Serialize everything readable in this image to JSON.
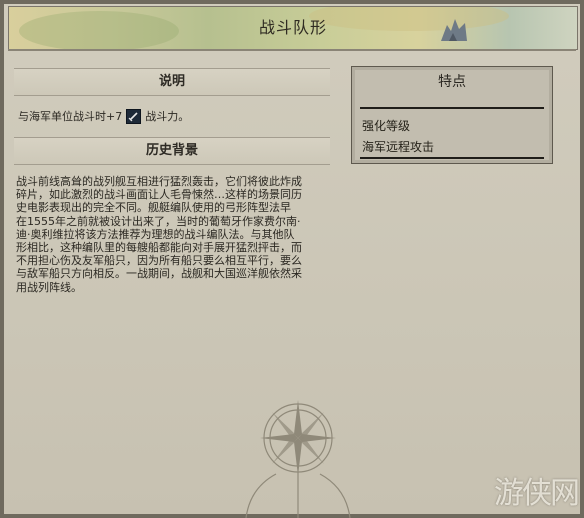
{
  "header": {
    "title": "战斗队形"
  },
  "description": {
    "heading": "说明",
    "text_before": "与海军单位战斗时+7",
    "icon": "sword-icon",
    "text_after": "战斗力。"
  },
  "history": {
    "heading": "历史背景",
    "lines": [
      "战斗前线高耸的战列舰互相进行猛烈轰击，它们将彼此炸成",
      "碎片，如此激烈的战斗画面让人毛骨悚然…这样的场景同历",
      "史电影表现出的完全不同。舰艇编队使用的弓形阵型法早",
      "在1555年之前就被设计出来了，当时的葡萄牙作家费尔南·",
      "迪·奥利维拉将该方法推荐为理想的战斗编队法。与其他队",
      "形相比，这种编队里的每艘船都能向对手展开猛烈抨击，而",
      "不用担心伤及友军船只，因为所有船只要么相互平行，要么",
      "与敌军船只方向相反。一战期间，战舰和大国巡洋舰依然采",
      "用战列阵线。"
    ]
  },
  "features": {
    "title": "特点",
    "items": [
      "强化等级",
      "海军远程攻击"
    ]
  },
  "watermark": "游侠网"
}
